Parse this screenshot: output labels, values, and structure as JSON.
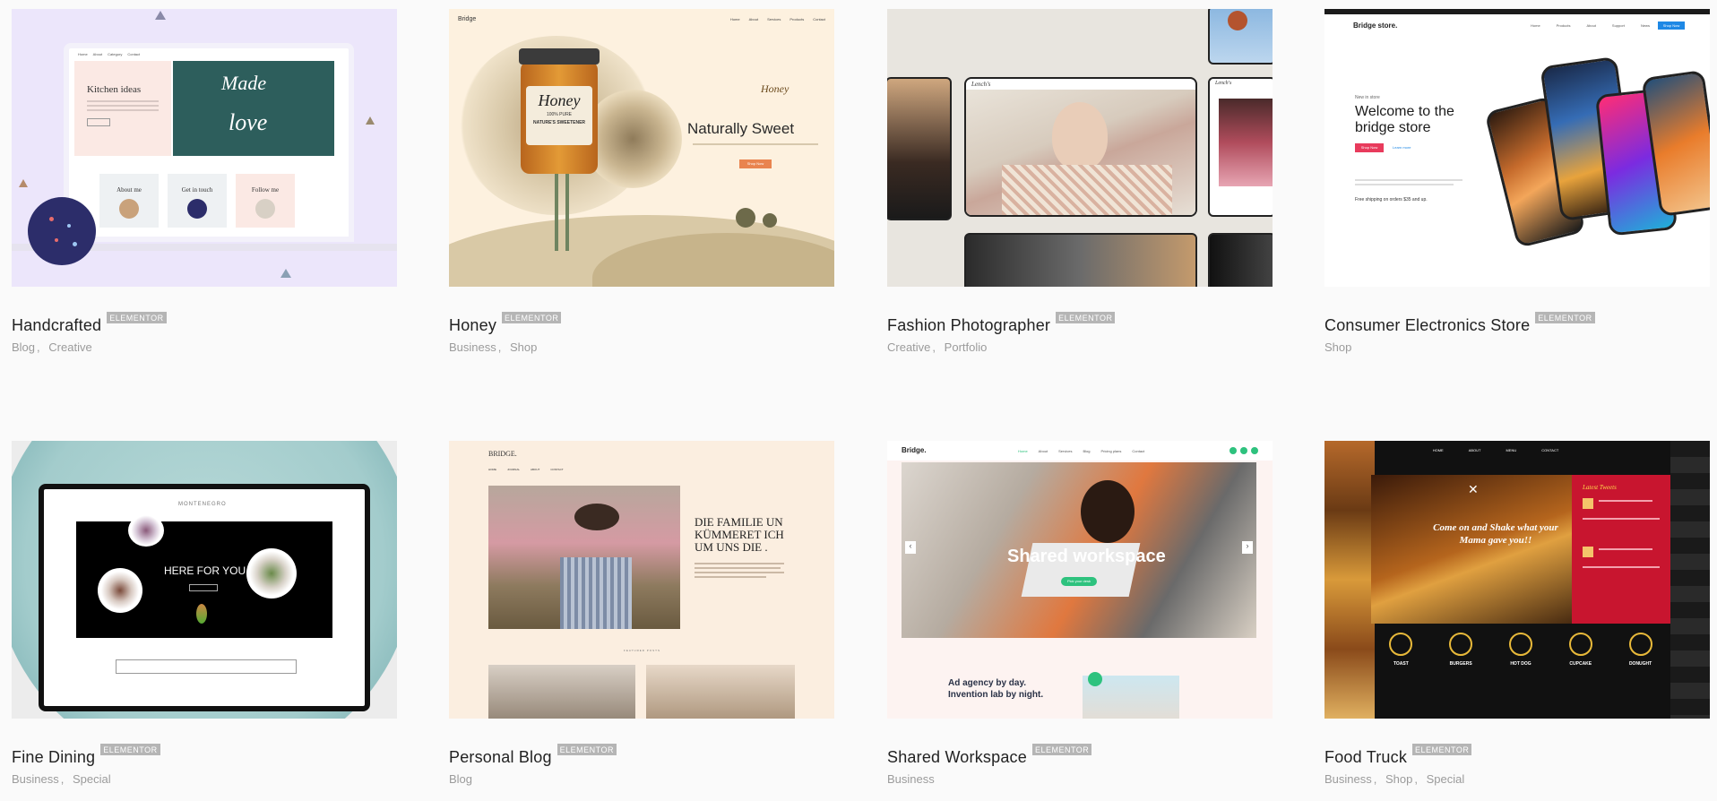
{
  "cards": [
    {
      "title": "Handcrafted",
      "badge": "ELEMENTOR",
      "categories": [
        "Blog",
        "Creative"
      ],
      "preview": {
        "nav": [
          "Home",
          "About",
          "Category",
          "Contact"
        ],
        "heading": "Kitchen ideas",
        "big_text_1": "Made",
        "big_text_2": "love",
        "boxes": [
          "About me",
          "Get in touch",
          "Follow me"
        ]
      }
    },
    {
      "title": "Honey",
      "badge": "ELEMENTOR",
      "categories": [
        "Business",
        "Shop"
      ],
      "preview": {
        "logo": "Bridge",
        "nav": [
          "Home",
          "About",
          "Services",
          "Products",
          "Contact"
        ],
        "jar_label": "Honey",
        "jar_sub": "100% PURE",
        "jar_tag": "NATURE'S SWEETENER",
        "headline": "Naturally Sweet",
        "cta": "Shop Now"
      }
    },
    {
      "title": "Fashion Photographer",
      "badge": "ELEMENTOR",
      "categories": [
        "Creative",
        "Portfolio"
      ],
      "preview": {
        "logo": "Lench's"
      }
    },
    {
      "title": "Consumer Electronics Store",
      "badge": "ELEMENTOR",
      "categories": [
        "Shop"
      ],
      "preview": {
        "logo": "Bridge store.",
        "nav": [
          "Home",
          "Products",
          "About",
          "Support",
          "News"
        ],
        "nav_cta": "Shop Now",
        "kicker": "New in store",
        "headline_1": "Welcome to the",
        "headline_2": "bridge store",
        "btn_primary": "Shop Now",
        "btn_link": "Learn more",
        "shipping": "Free shipping on orders $35 and up."
      }
    },
    {
      "title": "Fine Dining",
      "badge": "ELEMENTOR",
      "categories": [
        "Business",
        "Special"
      ],
      "preview": {
        "logo": "MONTENEGRO",
        "headline": "HERE FOR YOU"
      }
    },
    {
      "title": "Personal Blog",
      "badge": "ELEMENTOR",
      "categories": [
        "Blog"
      ],
      "preview": {
        "logo": "BRIDGE.",
        "nav": [
          "HOME",
          "JOURNAL",
          "ABOUT",
          "CONTACT"
        ],
        "heading_1": "DIE FAMILIE UN",
        "heading_2": "KÜMMERET ICH",
        "heading_3": "UM UNS DIE .",
        "section": "FEATURED POSTS"
      }
    },
    {
      "title": "Shared Workspace",
      "badge": "ELEMENTOR",
      "categories": [
        "Business"
      ],
      "preview": {
        "logo": "Bridge.",
        "nav": [
          "Home",
          "About",
          "Services",
          "Blog",
          "Pricing plans",
          "Contact"
        ],
        "headline": "Shared workspace",
        "cta": "Pick your desk",
        "tagline_1": "Ad agency by day.",
        "tagline_2": "Invention lab by night."
      }
    },
    {
      "title": "Food Truck",
      "badge": "ELEMENTOR",
      "categories": [
        "Business",
        "Shop",
        "Special"
      ],
      "preview": {
        "nav": [
          "HOME",
          "ABOUT",
          "MENU",
          "CONTACT"
        ],
        "headline_1": "Come on and Shake what your",
        "headline_2": "Mama gave you!!",
        "tweets_title": "Latest Tweets",
        "menu": [
          "TOAST",
          "BURGERS",
          "HOT DOG",
          "CUPCAKE",
          "DONUGHT"
        ]
      }
    }
  ],
  "colors": {
    "accent_honey": "#e9844f",
    "accent_store": "#e83b5c",
    "accent_workspace": "#2ec27e",
    "food_red": "#c8152f",
    "badge": "#b5b5b5"
  }
}
